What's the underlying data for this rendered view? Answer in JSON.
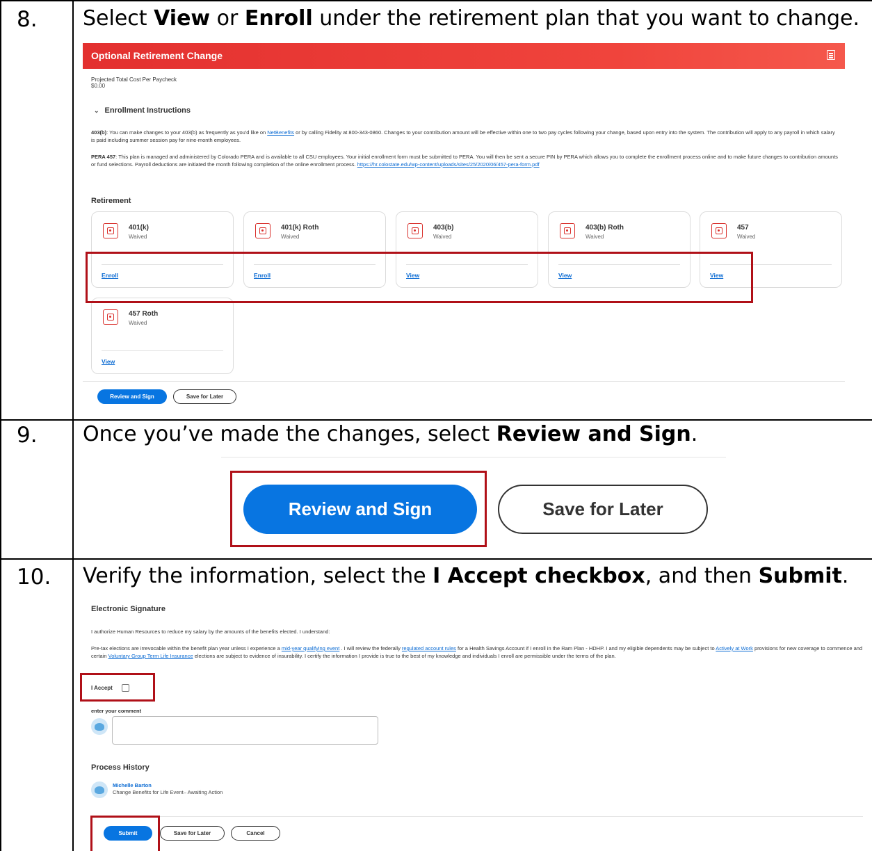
{
  "steps": [
    {
      "number": "8.",
      "text_parts": [
        "Select ",
        "View",
        " or ",
        "Enroll",
        " under the retirement plan that you want to change."
      ]
    },
    {
      "number": "9.",
      "text_parts": [
        "Once you’ve made the changes, select ",
        "Review and Sign",
        "."
      ]
    },
    {
      "number": "10.",
      "text_parts": [
        "Verify the information, select the ",
        "I Accept checkbox",
        ", and then ",
        "Submit",
        "."
      ]
    }
  ],
  "retirement_screen": {
    "banner_title": "Optional Retirement Change",
    "cost_label": "Projected Total Cost Per Paycheck",
    "cost_value": "$0.00",
    "instructions_title": "Enrollment Instructions",
    "p1_lead": "403(b)",
    "p1_text_a": ": You can make changes to your 403(b) as frequently as you'd like on ",
    "p1_link": "NetBenefits",
    "p1_text_b": " or by calling Fidelity at 800-343-0860. Changes to your contribution amount will be effective within one to two pay cycles following your change, based upon entry into the system. The contribution will apply to any payroll in which salary is paid including summer session pay for nine-month employees.",
    "p2_lead": "PERA 457",
    "p2_text": ": This plan is managed and administered by Colorado PERA and is available to all CSU employees. Your initial enrollment form must be submitted to PERA. You will then be sent a secure PIN by PERA which allows you to complete the enrollment process online and to make future changes to contribution amounts or fund selections. Payroll deductions are initiated the month following completion of the online enrollment process. ",
    "p2_link": "https://hr.colostate.edu/wp-content/uploads/sites/25/2020/06/457-pera-form.pdf",
    "retirement_heading": "Retirement",
    "plans": [
      {
        "name": "401(k)",
        "status": "Waived",
        "action": "Enroll"
      },
      {
        "name": "401(k) Roth",
        "status": "Waived",
        "action": "Enroll"
      },
      {
        "name": "403(b)",
        "status": "Waived",
        "action": "View"
      },
      {
        "name": "403(b) Roth",
        "status": "Waived",
        "action": "View"
      },
      {
        "name": "457",
        "status": "Waived",
        "action": "View"
      },
      {
        "name": "457 Roth",
        "status": "Waived",
        "action": "View"
      }
    ],
    "review_button": "Review and Sign",
    "save_button": "Save for Later"
  },
  "zoom_buttons": {
    "review_button": "Review and Sign",
    "save_button": "Save for Later"
  },
  "signature_screen": {
    "heading": "Electronic Signature",
    "authorize_text": "I authorize Human Resources to reduce my salary by the amounts of the benefits elected. I understand:",
    "legal_a": "Pre-tax elections are irrevocable within the benefit plan year unless I experience a ",
    "legal_link1": "mid-year qualifying event",
    "legal_b": " . I will review the federally ",
    "legal_link2": "regulated account rules",
    "legal_c": " for a Health Savings Account if I enroll in the Ram Plan - HDHP. I and my eligible dependents may be subject to ",
    "legal_link3": "Actively at Work",
    "legal_d": " provisions for new coverage to commence and certain ",
    "legal_link4": "Voluntary Group Term Life Insurance",
    "legal_e": " elections are subject to evidence of insurability. I certify the information I provide is true to the best of my knowledge and individuals I enroll are permissible under the terms of the plan.",
    "accept_label": "I Accept",
    "comment_label": "enter your comment",
    "history_heading": "Process History",
    "history_name": "Michelle Barton",
    "history_status": "Change Benefits for Life Event– Awaiting Action",
    "submit_button": "Submit",
    "save_button": "Save for Later",
    "cancel_button": "Cancel"
  }
}
